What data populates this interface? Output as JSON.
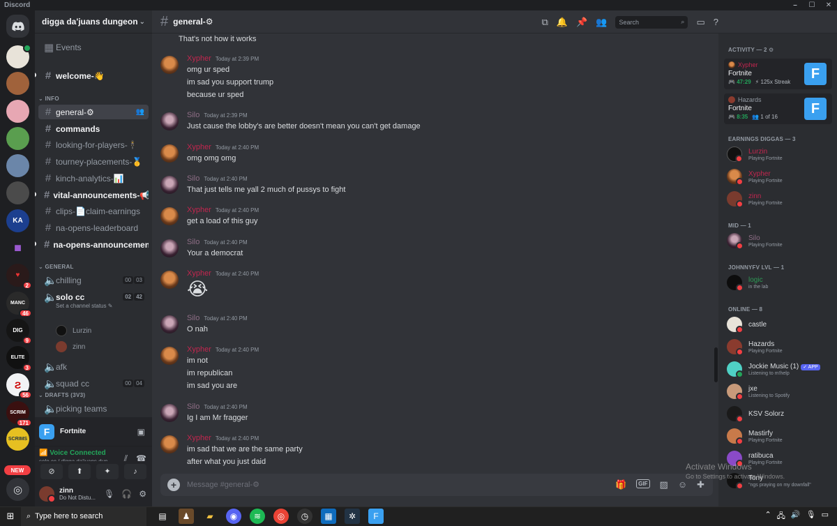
{
  "window": {
    "title": "Discord"
  },
  "server": {
    "name": "digga da'juans dungeon"
  },
  "channel_list": {
    "events_label": "Events",
    "welcome": "welcome-👋",
    "info_category": "INFO",
    "info_channels": [
      "general-⚙",
      "commands",
      "looking-for-players-🕴",
      "tourney-placements-🥇",
      "kinch-analytics-📊",
      "vital-announcements-📢",
      "clips-📄claim-earnings",
      "na-opens-leaderboard",
      "na-opens-announcemen..."
    ],
    "general_category": "GENERAL",
    "voice": {
      "chilling": {
        "name": "chilling",
        "c1": "00",
        "c2": "03"
      },
      "solo_cc": {
        "name": "solo cc",
        "c1": "02",
        "c2": "42",
        "status": "Set a channel status"
      },
      "users": [
        "Lurzin",
        "zinn"
      ],
      "afk": "afk",
      "squad_cc": {
        "name": "squad cc",
        "c1": "00",
        "c2": "04"
      }
    },
    "drafts_category": "DRAFTS (3V3)",
    "picking_teams": "picking teams"
  },
  "activity_panel": {
    "game": "Fortnite"
  },
  "voice_panel": {
    "status": "Voice Connected",
    "location": "solo cc / digga da'juans dun..."
  },
  "user_panel": {
    "name": "zinn",
    "status": "Do Not Distu..."
  },
  "header": {
    "channel": "general-⚙",
    "search_placeholder": "Search"
  },
  "messages": {
    "m0": {
      "text": "That's not how it works"
    },
    "m1": {
      "author": "Xypher",
      "time": "Today at 2:39 PM",
      "lines": [
        "omg ur sped",
        "im sad you support trump",
        "because ur sped"
      ]
    },
    "m2": {
      "author": "Silo",
      "time": "Today at 2:39 PM",
      "lines": [
        "Just cause the lobby's are better doesn't mean you can't get damage"
      ]
    },
    "m3": {
      "author": "Xypher",
      "time": "Today at 2:40 PM",
      "lines": [
        "omg omg omg"
      ]
    },
    "m4": {
      "author": "Silo",
      "time": "Today at 2:40 PM",
      "lines": [
        "That just tells me yall 2 much of pussys to fight"
      ]
    },
    "m5": {
      "author": "Xypher",
      "time": "Today at 2:40 PM",
      "lines": [
        "get a load of this guy"
      ]
    },
    "m6": {
      "author": "Silo",
      "time": "Today at 2:40 PM",
      "lines": [
        "Your a democrat"
      ]
    },
    "m7": {
      "author": "Xypher",
      "time": "Today at 2:40 PM",
      "emoji": "😭"
    },
    "m8": {
      "author": "Silo",
      "time": "Today at 2:40 PM",
      "lines": [
        "O nah"
      ]
    },
    "m9": {
      "author": "Xypher",
      "time": "Today at 2:40 PM",
      "lines": [
        "im not",
        "im republican",
        "im sad you are"
      ]
    },
    "m10": {
      "author": "Silo",
      "time": "Today at 2:40 PM",
      "lines": [
        "Ig I am Mr fragger"
      ]
    },
    "m11": {
      "author": "Xypher",
      "time": "Today at 2:40 PM",
      "lines": [
        "im sad that we are the same party",
        "after what you just daid"
      ]
    }
  },
  "composer": {
    "placeholder": "Message #general-⚙",
    "gif": "GIF"
  },
  "members": {
    "activity_header": "ACTIVITY — 2",
    "activities": [
      {
        "user": "Xypher",
        "game": "Fortnite",
        "time": "47:29",
        "extra": "125x Streak"
      },
      {
        "user": "Hazards",
        "game": "Fortnite",
        "time": "8:35",
        "extra": "1 of 16"
      }
    ],
    "earnings_header": "EARNINGS DIGGAS — 3",
    "earnings": [
      {
        "name": "Lurzin",
        "sub": "Playing Fortnite"
      },
      {
        "name": "Xypher",
        "sub": "Playing Fortnite"
      },
      {
        "name": "zinn",
        "sub": "Playing Fortnite"
      }
    ],
    "mid_header": "MID — 1",
    "mid": [
      {
        "name": "Silo",
        "sub": "Playing Fortnite"
      }
    ],
    "johnny_header": "JOHNNYFV LVL — 1",
    "johnny": [
      {
        "name": "logic",
        "sub": "in the lab"
      }
    ],
    "online_header": "ONLINE — 8",
    "online": [
      {
        "name": "castle",
        "sub": ""
      },
      {
        "name": "Hazards",
        "sub": "Playing Fortnite"
      },
      {
        "name": "Jockie Music (1)",
        "sub": "Listening to m!help",
        "tag": "✓ APP"
      },
      {
        "name": "jxe",
        "sub": "Listening to Spotify"
      },
      {
        "name": "KSV Solorz",
        "sub": ""
      },
      {
        "name": "Mastirfy",
        "sub": "Playing Fortnite"
      },
      {
        "name": "ratibuca",
        "sub": "Playing Fortnite"
      },
      {
        "name": "Tony",
        "sub": "\"ngs praying on my downfall\""
      }
    ]
  },
  "guild_badges": [
    "2",
    "46",
    "9",
    "3",
    "56",
    "171"
  ],
  "guild_labels": {
    "ka": "KA",
    "new": "NEW"
  },
  "watermark": {
    "title": "Activate Windows",
    "sub": "Go to Settings to activate Windows."
  },
  "taskbar": {
    "search_placeholder": "Type here to search"
  },
  "colors": {
    "accent": "#5865f2",
    "online": "#23a55a",
    "dnd": "#f23f43",
    "xypher": "#c3264f"
  }
}
